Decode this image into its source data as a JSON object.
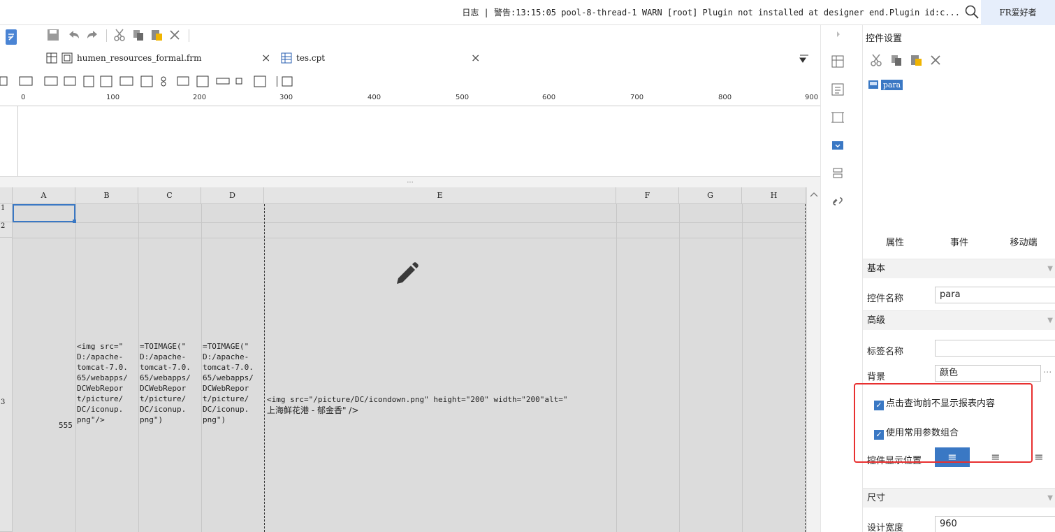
{
  "topbar": {
    "log_text": "日志 | 警告:13:15:05 pool-8-thread-1 WARN [root] Plugin not installed at designer end.Plugin id:c...",
    "user": "FR爱好者"
  },
  "tabs": [
    {
      "label": "humen_resources_formal.frm",
      "close": "×"
    },
    {
      "label": "tes.cpt",
      "close": "×"
    }
  ],
  "ruler": {
    "ticks": [
      "0",
      "100",
      "200",
      "300",
      "400",
      "500",
      "600",
      "700",
      "800",
      "900"
    ]
  },
  "splitter": {
    "label": "..."
  },
  "grid": {
    "columns": [
      "A",
      "B",
      "C",
      "D",
      "E",
      "F",
      "G",
      "H"
    ],
    "rows": [
      "1",
      "2",
      "3"
    ],
    "cells": {
      "A3": "555",
      "B3": "<img src=\"\nD:/apache-\ntomcat-7.0.\n65/webapps/\nDCWebRepor\nt/picture/\nDC/iconup.\npng\"/>",
      "C3": "=TOIMAGE(\"\nD:/apache-\ntomcat-7.0.\n65/webapps/\nDCWebRepor\nt/picture/\nDC/iconup.\npng\")",
      "D3": "=TOIMAGE(\"\nD:/apache-\ntomcat-7.0.\n65/webapps/\nDCWebRepor\nt/picture/\nDC/iconup.\npng\")",
      "E3_line1": "<img src=\"/picture/DC/icondown.png\" height=\"200\" width=\"200\"alt=\"",
      "E3_line2": "上海鲜花港 - 郁金香\" />"
    }
  },
  "panel": {
    "title": "控件设置",
    "widget_item": "para",
    "tabs": [
      "属性",
      "事件",
      "移动端"
    ],
    "sections": {
      "basic": "基本",
      "advanced": "高级",
      "size": "尺寸"
    },
    "fields": {
      "widget_name_label": "控件名称",
      "widget_name_value": "para",
      "tag_name_label": "标签名称",
      "tag_name_value": "",
      "background_label": "背景",
      "background_value": "颜色",
      "background_more": "···",
      "check1": "点击查询前不显示报表内容",
      "check2": "使用常用参数组合",
      "display_pos_label": "控件显示位置",
      "design_width_label": "设计宽度",
      "design_width_value": "960"
    }
  },
  "colors": {
    "accent": "#3a78c4",
    "highlight": "#e83030",
    "cell_bg": "#dcdcdc"
  },
  "icons": [
    "search-icon",
    "save-icon",
    "undo-icon",
    "redo-icon",
    "cut-icon",
    "copy-icon",
    "paste-icon",
    "delete-icon",
    "pencil-icon",
    "link-icon"
  ]
}
